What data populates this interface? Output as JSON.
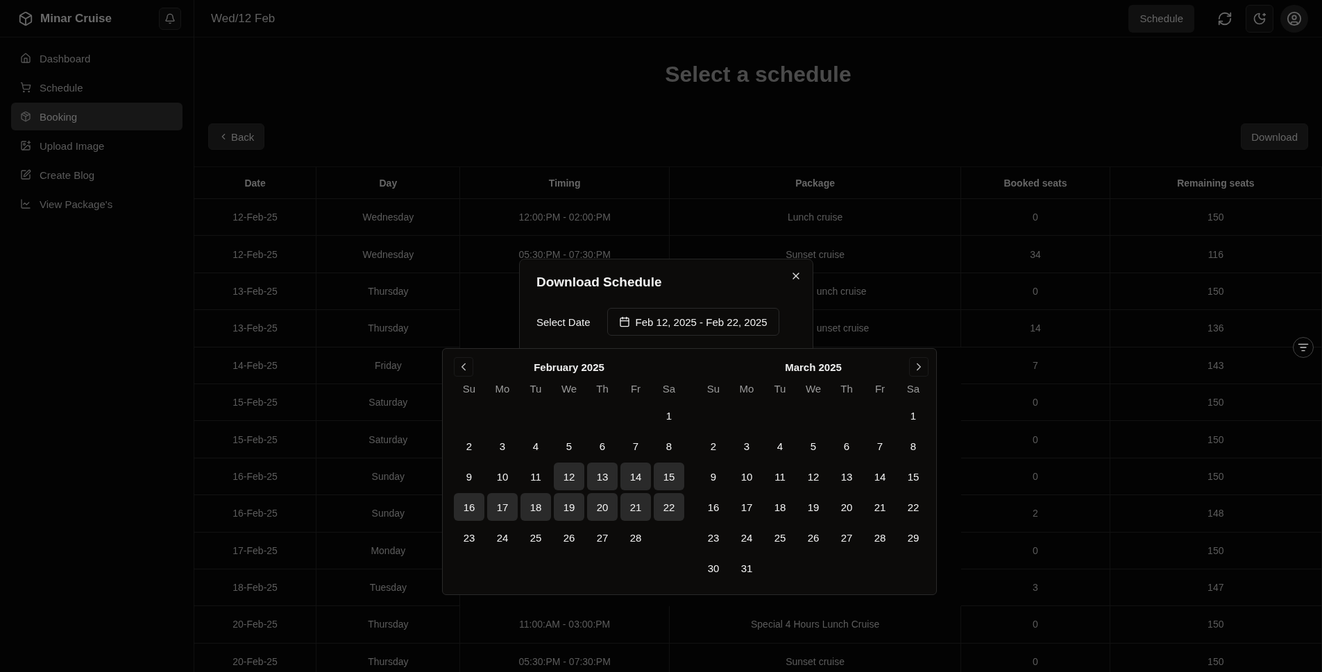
{
  "sidebar": {
    "brand": "Minar Cruise",
    "items": [
      {
        "label": "Dashboard",
        "selected": false
      },
      {
        "label": "Schedule",
        "selected": false
      },
      {
        "label": "Booking",
        "selected": true
      },
      {
        "label": "Upload Image",
        "selected": false
      },
      {
        "label": "Create Blog",
        "selected": false
      },
      {
        "label": "View Package's",
        "selected": false
      }
    ]
  },
  "header": {
    "date": "Wed/12 Feb",
    "schedule_button": "Schedule"
  },
  "page": {
    "title": "Select a schedule",
    "back_button": "Back",
    "download_button": "Download"
  },
  "table": {
    "columns": [
      "Date",
      "Day",
      "Timing",
      "Package",
      "Booked seats",
      "Remaining seats"
    ],
    "rows": [
      {
        "date": "12-Feb-25",
        "day": "Wednesday",
        "timing": "12:00:PM - 02:00:PM",
        "package": "Lunch cruise",
        "booked": "0",
        "remaining": "150"
      },
      {
        "date": "12-Feb-25",
        "day": "Wednesday",
        "timing": "05:30:PM - 07:30:PM",
        "package": "Sunset cruise",
        "booked": "34",
        "remaining": "116"
      },
      {
        "date": "13-Feb-25",
        "day": "Thursday",
        "package": "unch cruise",
        "package_clipped": true,
        "booked": "0",
        "remaining": "150"
      },
      {
        "date": "13-Feb-25",
        "day": "Thursday",
        "package": "unset cruise",
        "package_clipped": true,
        "booked": "14",
        "remaining": "136"
      },
      {
        "date": "14-Feb-25",
        "day": "Friday",
        "booked": "7",
        "remaining": "143"
      },
      {
        "date": "15-Feb-25",
        "day": "Saturday",
        "booked": "0",
        "remaining": "150"
      },
      {
        "date": "15-Feb-25",
        "day": "Saturday",
        "booked": "0",
        "remaining": "150"
      },
      {
        "date": "16-Feb-25",
        "day": "Sunday",
        "booked": "0",
        "remaining": "150"
      },
      {
        "date": "16-Feb-25",
        "day": "Sunday",
        "booked": "2",
        "remaining": "148"
      },
      {
        "date": "17-Feb-25",
        "day": "Monday",
        "booked": "0",
        "remaining": "150"
      },
      {
        "date": "18-Feb-25",
        "day": "Tuesday",
        "booked": "3",
        "remaining": "147"
      },
      {
        "date": "20-Feb-25",
        "day": "Thursday",
        "timing": "11:00:AM - 03:00:PM",
        "package": "Special 4 Hours Lunch Cruise",
        "booked": "0",
        "remaining": "150"
      },
      {
        "date": "20-Feb-25",
        "day": "Thursday",
        "timing": "05:30:PM - 07:30:PM",
        "package": "Sunset cruise",
        "booked": "0",
        "remaining": "150"
      }
    ]
  },
  "dialog": {
    "title": "Download Schedule",
    "label": "Select Date",
    "date_range": "Feb 12, 2025 - Feb 22, 2025"
  },
  "calendar": {
    "months": [
      {
        "title": "February 2025",
        "weekdays": [
          "Su",
          "Mo",
          "Tu",
          "We",
          "Th",
          "Fr",
          "Sa"
        ],
        "weeks": [
          [
            {
              "label": "1",
              "selected": false
            }
          ],
          [
            {
              "label": "2",
              "selected": false
            },
            {
              "label": "3",
              "selected": false
            },
            {
              "label": "4",
              "selected": false
            },
            {
              "label": "5",
              "selected": false
            },
            {
              "label": "6",
              "selected": false
            },
            {
              "label": "7",
              "selected": false
            },
            {
              "label": "8",
              "selected": false
            }
          ],
          [
            {
              "label": "9",
              "selected": false
            },
            {
              "label": "10",
              "selected": false
            },
            {
              "label": "11",
              "selected": false
            },
            {
              "label": "12",
              "selected": true
            },
            {
              "label": "13",
              "selected": true
            },
            {
              "label": "14",
              "selected": true
            },
            {
              "label": "15",
              "selected": true
            }
          ],
          [
            {
              "label": "16",
              "selected": true
            },
            {
              "label": "17",
              "selected": true
            },
            {
              "label": "18",
              "selected": true
            },
            {
              "label": "19",
              "selected": true
            },
            {
              "label": "20",
              "selected": true
            },
            {
              "label": "21",
              "selected": true
            },
            {
              "label": "22",
              "selected": true
            }
          ],
          [
            {
              "label": "23",
              "selected": false
            },
            {
              "label": "24",
              "selected": false
            },
            {
              "label": "25",
              "selected": false
            },
            {
              "label": "26",
              "selected": false
            },
            {
              "label": "27",
              "selected": false
            },
            {
              "label": "28",
              "selected": false
            }
          ]
        ]
      },
      {
        "title": "March 2025",
        "weekdays": [
          "Su",
          "Mo",
          "Tu",
          "We",
          "Th",
          "Fr",
          "Sa"
        ],
        "weeks": [
          [
            {
              "label": "1",
              "selected": false
            }
          ],
          [
            {
              "label": "2",
              "selected": false
            },
            {
              "label": "3",
              "selected": false
            },
            {
              "label": "4",
              "selected": false
            },
            {
              "label": "5",
              "selected": false
            },
            {
              "label": "6",
              "selected": false
            },
            {
              "label": "7",
              "selected": false
            },
            {
              "label": "8",
              "selected": false
            }
          ],
          [
            {
              "label": "9",
              "selected": false
            },
            {
              "label": "10",
              "selected": false
            },
            {
              "label": "11",
              "selected": false
            },
            {
              "label": "12",
              "selected": false
            },
            {
              "label": "13",
              "selected": false
            },
            {
              "label": "14",
              "selected": false
            },
            {
              "label": "15",
              "selected": false
            }
          ],
          [
            {
              "label": "16",
              "selected": false
            },
            {
              "label": "17",
              "selected": false
            },
            {
              "label": "18",
              "selected": false
            },
            {
              "label": "19",
              "selected": false
            },
            {
              "label": "20",
              "selected": false
            },
            {
              "label": "21",
              "selected": false
            },
            {
              "label": "22",
              "selected": false
            }
          ],
          [
            {
              "label": "23",
              "selected": false
            },
            {
              "label": "24",
              "selected": false
            },
            {
              "label": "25",
              "selected": false
            },
            {
              "label": "26",
              "selected": false
            },
            {
              "label": "27",
              "selected": false
            },
            {
              "label": "28",
              "selected": false
            },
            {
              "label": "29",
              "selected": false
            }
          ],
          [
            {
              "label": "30",
              "selected": false
            },
            {
              "label": "31",
              "selected": false
            }
          ]
        ]
      }
    ]
  }
}
